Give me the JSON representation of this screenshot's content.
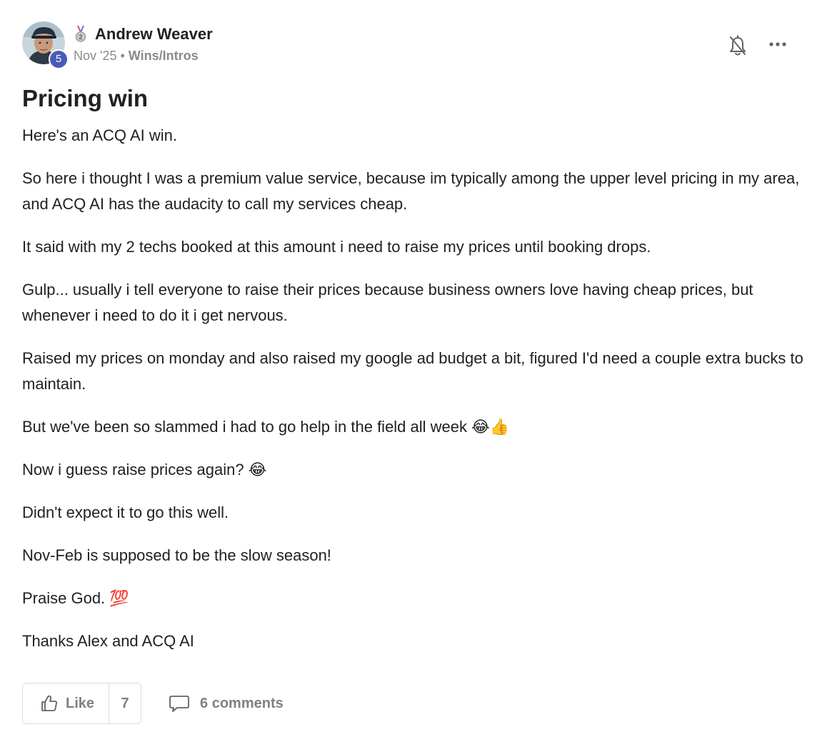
{
  "post": {
    "author": {
      "name": "Andrew Weaver",
      "level": "5",
      "medal_icon": "second-place-medal-icon"
    },
    "date": "Nov '25",
    "separator": "•",
    "category": "Wins/Intros",
    "title": "Pricing win",
    "paragraphs": [
      "Here's an ACQ AI win.",
      "So here i thought I was a premium value service, because im typically among the upper level pricing in my area, and ACQ AI has the audacity to call my services cheap.",
      "It said with my 2 techs booked at this amount i need to raise my prices until booking drops.",
      "Gulp... usually i tell everyone to raise their prices because business owners love having cheap prices, but whenever i need to do it i get nervous.",
      "Raised my prices on monday and also raised my google ad budget a bit, figured I'd need a couple extra bucks to maintain.",
      "But we've been so slammed i had to go help in the field all week 😂👍",
      "Now i guess raise prices again? 😂",
      "Didn't expect it to go this well.",
      "Nov-Feb is supposed to be the slow season!",
      "Praise God. 💯",
      "Thanks Alex and ACQ AI"
    ]
  },
  "actions": {
    "like_label": "Like",
    "like_count": "7",
    "comments_label": "6 comments"
  },
  "colors": {
    "level_badge": "#4a5ab7",
    "muted_text": "#8a8a8a",
    "border": "#dadce0"
  }
}
